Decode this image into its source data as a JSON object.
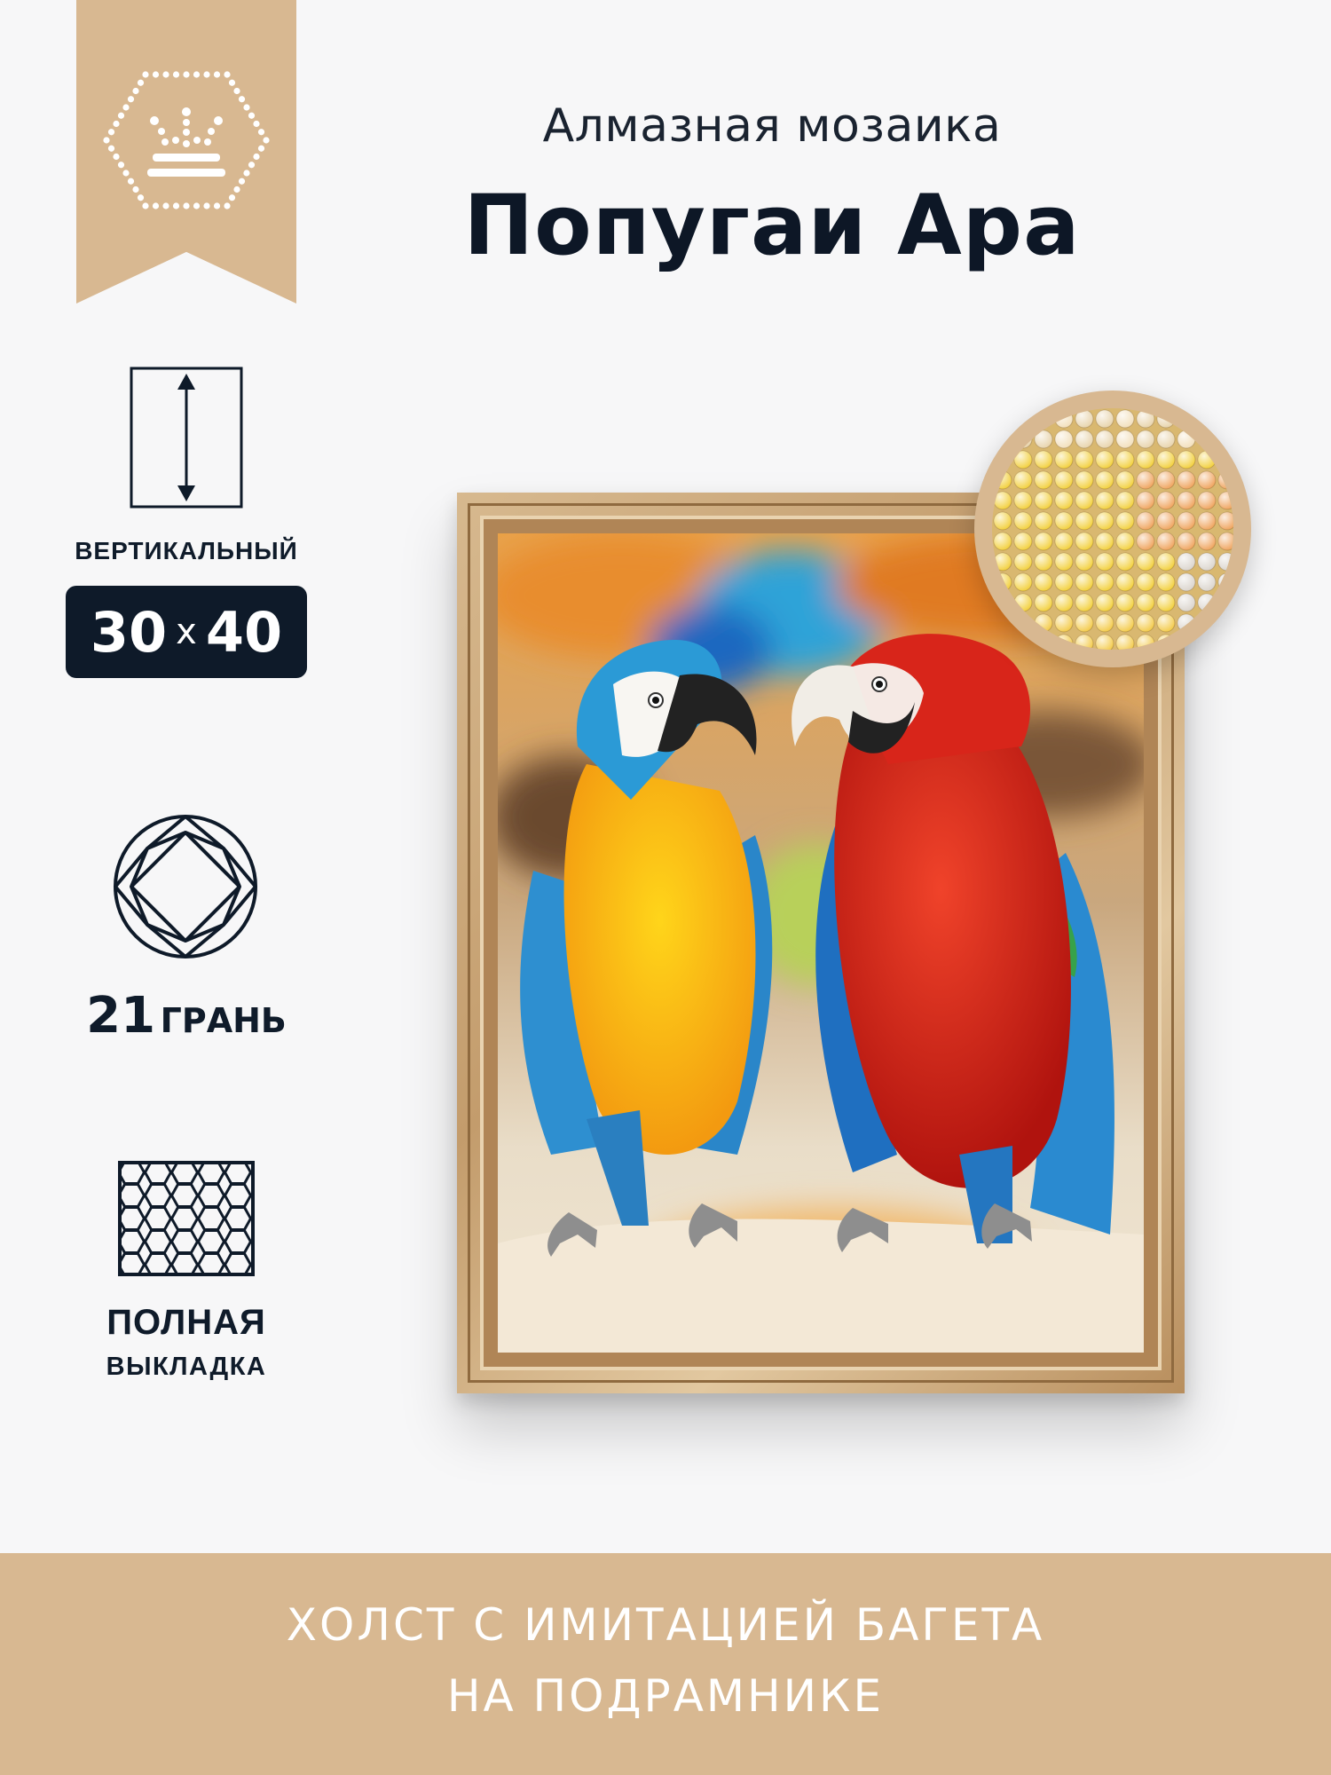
{
  "header": {
    "subtitle": "Алмазная мозаика",
    "title": "Попугаи Ара"
  },
  "features": {
    "orientation": "ВЕРТИКАЛЬНЫЙ",
    "size": {
      "width": "30",
      "separator": "x",
      "height": "40"
    },
    "facets": {
      "number": "21",
      "word": "ГРАНЬ"
    },
    "layout": {
      "line1": "ПОЛНАЯ",
      "line2": "ВЫКЛАДКА"
    }
  },
  "banner": {
    "line1": "ХОЛСТ С ИМИТАЦИЕЙ БАГЕТА",
    "line2": "НА ПОДРАМНИКЕ"
  },
  "icons": {
    "logo": "crown-hexagon-icon",
    "orientation": "vertical-canvas-icon",
    "facets": "diamond-icon",
    "layout": "honeycomb-icon"
  },
  "colors": {
    "accent": "#d8b891",
    "dark": "#0e1a29",
    "background": "#f7f7f8"
  }
}
